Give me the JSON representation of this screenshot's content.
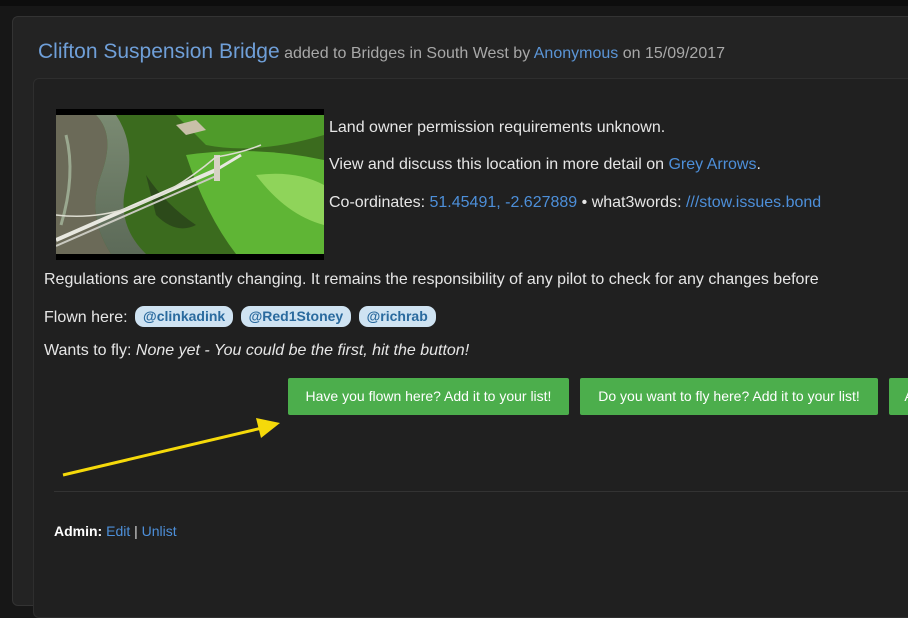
{
  "header": {
    "title": "Clifton Suspension Bridge",
    "added_to": "added to Bridges in South West by",
    "user": "Anonymous",
    "on_date": "on 15/09/2017"
  },
  "info": {
    "permission": "Land owner permission requirements unknown.",
    "discuss_prefix": "View and discuss this location in more detail on",
    "discuss_link": "Grey Arrows",
    "discuss_suffix": ".",
    "coords_label": "Co-ordinates:",
    "coords_value": "51.45491, -2.627889",
    "w3w_label": "• what3words:",
    "w3w_value": "///stow.issues.bond"
  },
  "regulations": "Regulations are constantly changing. It remains the responsibility of any pilot to check for any changes before",
  "flown_here": {
    "label": "Flown here:",
    "tags": [
      "@clinkadink",
      "@Red1Stoney",
      "@richrab"
    ]
  },
  "wants_to_fly": {
    "label": "Wants to fly:",
    "value": "None yet - You could be the first, hit the button!"
  },
  "buttons": {
    "flown": "Have you flown here? Add it to your list!",
    "want": "Do you want to fly here? Add it to your list!",
    "third": "A"
  },
  "admin": {
    "label": "Admin:",
    "edit": "Edit",
    "separator": "|",
    "unlist": "Unlist"
  },
  "colors": {
    "link": "#4d8fd9",
    "button": "#4cae4c",
    "tag_bg": "#cfe3f2",
    "arrow": "#f5d90a"
  }
}
